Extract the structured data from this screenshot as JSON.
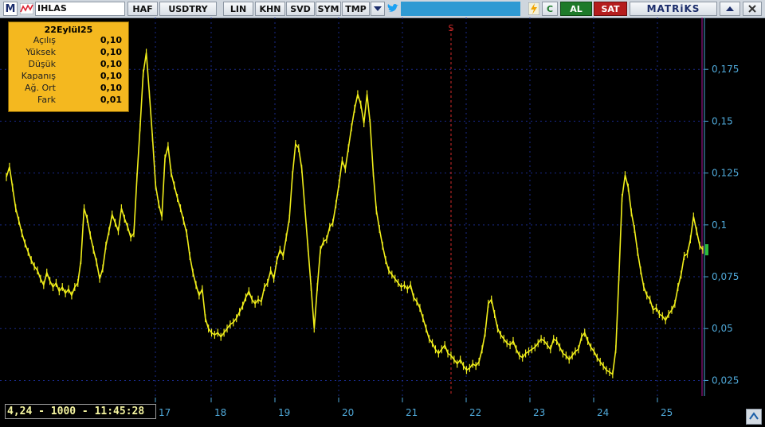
{
  "toolbar": {
    "logo_letter": "M",
    "symbol": "IHLAS",
    "buttons": [
      "HAF",
      "USDTRY",
      "LIN",
      "KHN",
      "SVD",
      "SYM",
      "TMP"
    ],
    "refresh_label": "C",
    "buy_label": "AL",
    "sell_label": "SAT",
    "brand": "MATRiKS"
  },
  "info_box": {
    "date": "22Eylül25",
    "rows": [
      {
        "label": "Açılış",
        "value": "0,10"
      },
      {
        "label": "Yüksek",
        "value": "0,10"
      },
      {
        "label": "Düşük",
        "value": "0,10"
      },
      {
        "label": "Kapanış",
        "value": "0,10"
      },
      {
        "label": "Ağ. Ort",
        "value": "0,10"
      },
      {
        "label": "Fark",
        "value": "0,01"
      }
    ]
  },
  "status_text": "4,24 - 1000 - 11:45:28",
  "chart_marker": "S",
  "colors": {
    "series": "#f0ee1a",
    "grid": "#1a2a8a",
    "marker": "#d62a2a",
    "axis_text": "#4fa8d8"
  },
  "chart_data": {
    "type": "line",
    "title": "",
    "xlabel": "",
    "ylabel": "",
    "x_ticks": [
      "17",
      "18",
      "19",
      "20",
      "21",
      "22",
      "23",
      "24",
      "25"
    ],
    "y_ticks": [
      "0,025",
      "0,05",
      "0,075",
      "0,1",
      "0,125",
      "0,15",
      "0,175"
    ],
    "ylim": [
      0.0175,
      0.2
    ],
    "grid": true,
    "series": [
      {
        "values": [
          0.123,
          0.128,
          0.118,
          0.108,
          0.102,
          0.096,
          0.091,
          0.087,
          0.083,
          0.08,
          0.078,
          0.074,
          0.071,
          0.077,
          0.073,
          0.07,
          0.072,
          0.068,
          0.07,
          0.067,
          0.069,
          0.066,
          0.07,
          0.072,
          0.083,
          0.108,
          0.103,
          0.095,
          0.088,
          0.082,
          0.074,
          0.079,
          0.09,
          0.097,
          0.105,
          0.101,
          0.097,
          0.108,
          0.103,
          0.099,
          0.094,
          0.096,
          0.123,
          0.147,
          0.173,
          0.183,
          0.163,
          0.142,
          0.119,
          0.11,
          0.104,
          0.132,
          0.138,
          0.125,
          0.119,
          0.113,
          0.108,
          0.102,
          0.096,
          0.085,
          0.077,
          0.071,
          0.066,
          0.069,
          0.055,
          0.05,
          0.048,
          0.047,
          0.048,
          0.046,
          0.048,
          0.05,
          0.052,
          0.053,
          0.055,
          0.058,
          0.061,
          0.065,
          0.068,
          0.064,
          0.062,
          0.064,
          0.063,
          0.07,
          0.072,
          0.078,
          0.074,
          0.083,
          0.088,
          0.085,
          0.094,
          0.103,
          0.124,
          0.139,
          0.137,
          0.127,
          0.108,
          0.089,
          0.07,
          0.05,
          0.07,
          0.088,
          0.092,
          0.093,
          0.099,
          0.101,
          0.11,
          0.12,
          0.131,
          0.127,
          0.137,
          0.147,
          0.156,
          0.163,
          0.158,
          0.149,
          0.163,
          0.149,
          0.125,
          0.107,
          0.098,
          0.09,
          0.083,
          0.078,
          0.076,
          0.074,
          0.072,
          0.07,
          0.071,
          0.069,
          0.071,
          0.065,
          0.063,
          0.06,
          0.055,
          0.05,
          0.045,
          0.043,
          0.04,
          0.038,
          0.04,
          0.042,
          0.038,
          0.037,
          0.035,
          0.033,
          0.035,
          0.032,
          0.03,
          0.031,
          0.033,
          0.032,
          0.034,
          0.04,
          0.048,
          0.062,
          0.064,
          0.057,
          0.05,
          0.047,
          0.045,
          0.043,
          0.042,
          0.044,
          0.04,
          0.037,
          0.036,
          0.038,
          0.039,
          0.04,
          0.041,
          0.043,
          0.045,
          0.044,
          0.042,
          0.04,
          0.045,
          0.044,
          0.041,
          0.038,
          0.037,
          0.035,
          0.037,
          0.039,
          0.04,
          0.046,
          0.048,
          0.044,
          0.041,
          0.039,
          0.036,
          0.034,
          0.032,
          0.03,
          0.029,
          0.028,
          0.04,
          0.075,
          0.113,
          0.124,
          0.118,
          0.106,
          0.098,
          0.087,
          0.078,
          0.07,
          0.066,
          0.064,
          0.059,
          0.06,
          0.057,
          0.056,
          0.054,
          0.057,
          0.059,
          0.062,
          0.07,
          0.076,
          0.085,
          0.086,
          0.093,
          0.104,
          0.097,
          0.09,
          0.088
        ]
      }
    ]
  }
}
